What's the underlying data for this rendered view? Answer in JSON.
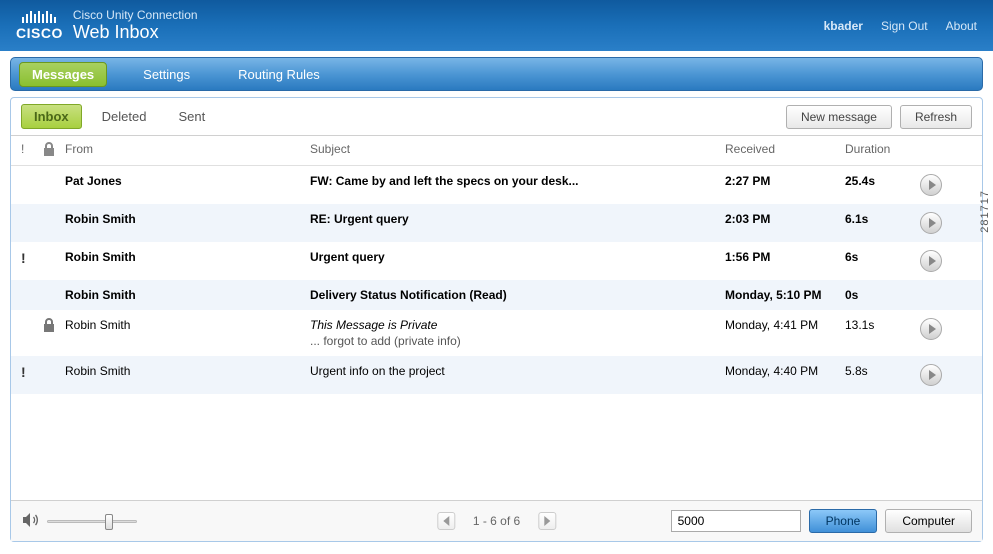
{
  "header": {
    "product": "Cisco Unity Connection",
    "app": "Web Inbox",
    "user": "kbader",
    "signout": "Sign Out",
    "about": "About",
    "brand": "CISCO"
  },
  "nav": {
    "items": [
      {
        "label": "Messages",
        "active": true
      },
      {
        "label": "Settings",
        "active": false
      },
      {
        "label": "Routing Rules",
        "active": false
      }
    ]
  },
  "subnav": {
    "items": [
      {
        "label": "Inbox",
        "active": true
      },
      {
        "label": "Deleted",
        "active": false
      },
      {
        "label": "Sent",
        "active": false
      }
    ],
    "new_message": "New message",
    "refresh": "Refresh"
  },
  "columns": {
    "urgent": "!",
    "from": "From",
    "subject": "Subject",
    "received": "Received",
    "duration": "Duration"
  },
  "messages": [
    {
      "urgent": false,
      "private": false,
      "unread": true,
      "from": "Pat Jones",
      "subject": "FW: Came by and left the specs on your desk...",
      "subline": "",
      "received": "2:27 PM",
      "duration": "25.4s",
      "playable": true
    },
    {
      "urgent": false,
      "private": false,
      "unread": true,
      "from": "Robin Smith",
      "subject": "RE: Urgent query",
      "subline": "",
      "received": "2:03 PM",
      "duration": "6.1s",
      "playable": true
    },
    {
      "urgent": true,
      "private": false,
      "unread": true,
      "from": "Robin Smith",
      "subject": "Urgent query",
      "subline": "",
      "received": "1:56 PM",
      "duration": "6s",
      "playable": true
    },
    {
      "urgent": false,
      "private": false,
      "unread": true,
      "from": "Robin Smith",
      "subject": "Delivery Status Notification (Read)",
      "subline": "",
      "received": "Monday, 5:10 PM",
      "duration": "0s",
      "playable": false
    },
    {
      "urgent": false,
      "private": true,
      "unread": false,
      "from": "Robin Smith",
      "subject": "This Message is Private",
      "subline": "... forgot to add (private info)",
      "received": "Monday, 4:41 PM",
      "duration": "13.1s",
      "playable": true
    },
    {
      "urgent": true,
      "private": false,
      "unread": false,
      "from": "Robin Smith",
      "subject": "Urgent info on the project",
      "subline": "",
      "received": "Monday, 4:40 PM",
      "duration": "5.8s",
      "playable": true
    }
  ],
  "footer": {
    "pager": "1 - 6 of 6",
    "extension": "5000",
    "phone": "Phone",
    "computer": "Computer"
  },
  "watermark": "281717"
}
